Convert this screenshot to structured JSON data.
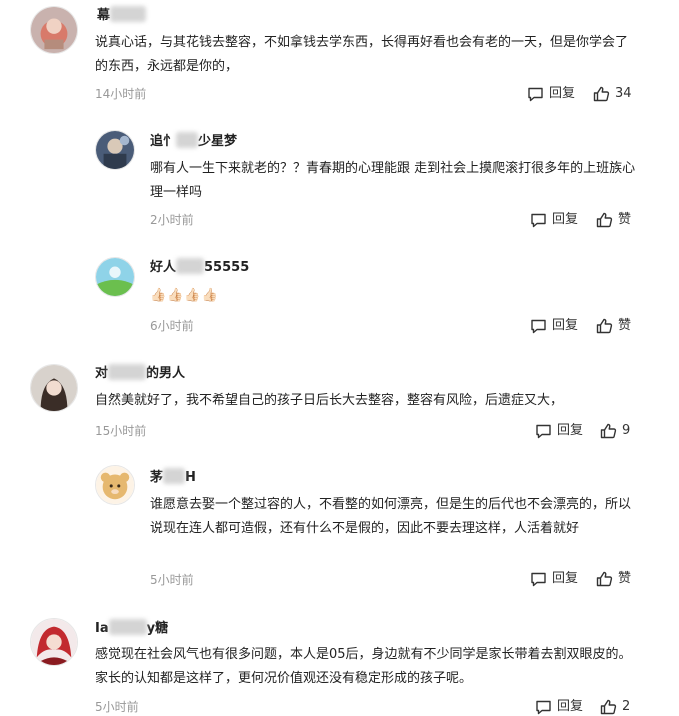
{
  "comments": [
    {
      "name_before": "幕",
      "name_after": "",
      "text": "说真心话，与其花钱去整容，不如拿钱去学东西，长得再好看也会有老的一天，但是你学会了的东西，永远都是你的，",
      "time": "14小时前",
      "reply_label": "回复",
      "like_label": "34"
    },
    {
      "name_before": "追忄",
      "name_after": "少星梦",
      "text": "哪有人一生下来就老的？？青春期的心理能跟 走到社会上摸爬滚打很多年的上班族心理一样吗",
      "time": "2小时前",
      "reply_label": "回复",
      "like_label": "赞"
    },
    {
      "name_before": "好人",
      "name_after": "55555",
      "emoji": "👍🏻👍🏻👍🏻👍🏻",
      "time": "6小时前",
      "reply_label": "回复",
      "like_label": "赞"
    },
    {
      "name_before": "对",
      "name_after": "的男人",
      "text": "自然美就好了，我不希望自己的孩子日后长大去整容，整容有风险，后遗症又大，",
      "time": "15小时前",
      "reply_label": "回复",
      "like_label": "9"
    },
    {
      "name_before": "茅",
      "name_after": "H",
      "text": "谁愿意去娶一个整过容的人，不看整的如何漂亮，但是生的后代也不会漂亮的，所以说现在连人都可造假，还有什么不是假的，因此不要去理这样，人活着就好",
      "time": "5小时前",
      "reply_label": "回复",
      "like_label": "赞"
    },
    {
      "name_before": "Ia",
      "name_after": "y糖",
      "text": "感觉现在社会风气也有很多问题，本人是05后，身边就有不少同学是家长带着去割双眼皮的。家长的认知都是这样了，更何况价值观还没有稳定形成的孩子呢。",
      "time": "5小时前",
      "reply_label": "回复",
      "like_label": "2"
    }
  ],
  "icons": {
    "reply": "comment-bubble-icon",
    "like": "thumbs-up-icon"
  },
  "colors": {
    "time_text": "#999999",
    "body_text": "#222222",
    "name_text": "#222222"
  }
}
